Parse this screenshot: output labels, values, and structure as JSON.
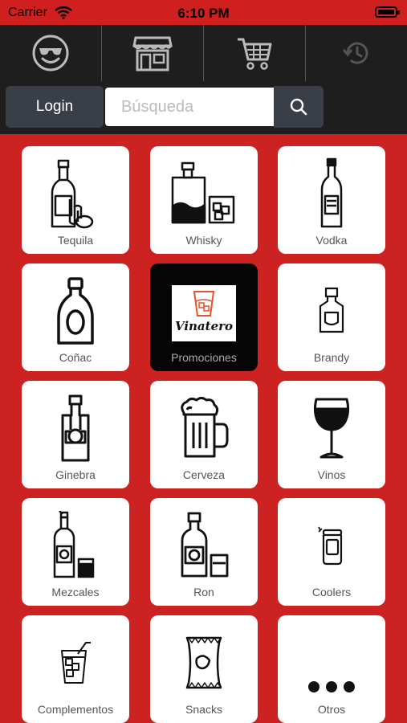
{
  "status_bar": {
    "carrier": "Carrier",
    "time": "6:10 PM"
  },
  "top_nav": [
    {
      "icon": "smiley-sunglasses-icon"
    },
    {
      "icon": "store-icon"
    },
    {
      "icon": "cart-icon"
    },
    {
      "icon": "history-icon"
    }
  ],
  "search": {
    "login_label": "Login",
    "placeholder": "Búsqueda"
  },
  "colors": {
    "background": "#cc2222",
    "nav": "#1e1e1e",
    "button": "#3a3f47"
  },
  "categories": [
    {
      "label": "Tequila",
      "icon": "tequila-icon"
    },
    {
      "label": "Whisky",
      "icon": "whisky-icon"
    },
    {
      "label": "Vodka",
      "icon": "vodka-icon"
    },
    {
      "label": "Coñac",
      "icon": "cognac-icon"
    },
    {
      "label": "Promociones",
      "icon": "vinatero-logo",
      "logo_text": "Vinatero"
    },
    {
      "label": "Brandy",
      "icon": "brandy-icon"
    },
    {
      "label": "Ginebra",
      "icon": "gin-icon"
    },
    {
      "label": "Cerveza",
      "icon": "beer-icon"
    },
    {
      "label": "Vinos",
      "icon": "wine-icon"
    },
    {
      "label": "Mezcales",
      "icon": "mezcal-icon"
    },
    {
      "label": "Ron",
      "icon": "rum-icon"
    },
    {
      "label": "Coolers",
      "icon": "cooler-can-icon"
    },
    {
      "label": "Complementos",
      "icon": "cocktail-icon"
    },
    {
      "label": "Snacks",
      "icon": "snacks-bag-icon"
    },
    {
      "label": "Otros",
      "icon": "more-dots-icon"
    }
  ]
}
